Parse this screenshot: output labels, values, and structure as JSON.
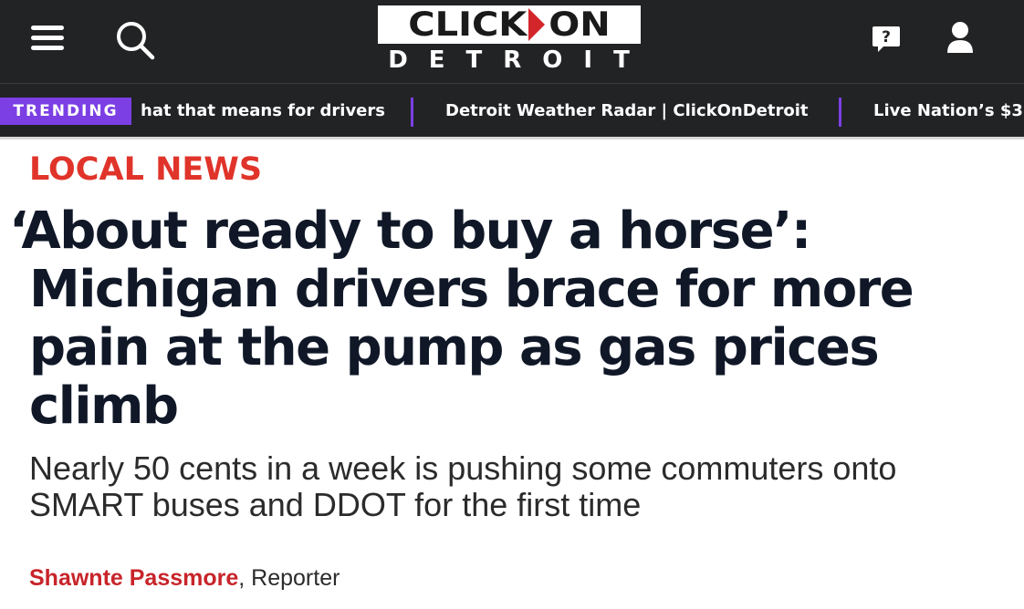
{
  "header": {
    "logo": {
      "top": "CLICK",
      "top2": "ON",
      "bottom": "DETROIT"
    },
    "icons": [
      "menu-icon",
      "search-icon",
      "help-icon",
      "user-icon"
    ],
    "background": "#222325"
  },
  "trending": {
    "label": "TRENDING",
    "items": [
      "hat that means for drivers",
      "Detroit Weather Radar | ClickOnDetroit",
      "Live Nation’s $3"
    ],
    "accent": "#7b3fe4"
  },
  "article": {
    "section": "LOCAL NEWS",
    "headline_line1": "‘About ready to buy a horse’:",
    "headline_line2": "Michigan drivers brace for more",
    "headline_line3": "pain at the pump as gas prices",
    "headline_line4": "climb",
    "subhead_line1": "Nearly 50 cents in a week is pushing some commuters onto",
    "subhead_line2": "SMART buses and DDOT for the first time",
    "author": "Shawnte Passmore",
    "role": ", Reporter",
    "section_color": "#e0342b",
    "author_color": "#c8242a"
  }
}
